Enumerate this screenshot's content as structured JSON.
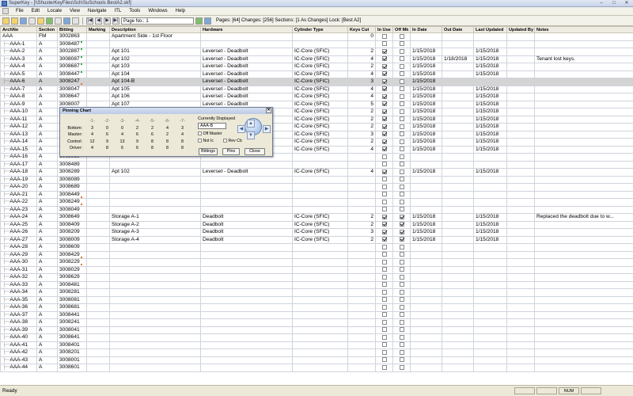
{
  "window": {
    "title": "SuperKey - [\\\\ShusterKeyFiles\\Sch\\SuSchools BestA2.skf]"
  },
  "menu": [
    "File",
    "Edit",
    "Locate",
    "View",
    "Navigate",
    "ITL",
    "Tools",
    "Windows",
    "Help"
  ],
  "toolbar": {
    "page_no": "Page No.: 1",
    "status": "Pages: [64]  Changes: [256]  Sections: [1 As Changes]  Lock: [Best A2]"
  },
  "columns": [
    "ArchNo",
    "Section",
    "Bitting",
    "Marking",
    "Description",
    "Hardware",
    "Cylinder Type",
    "Keys Cut",
    "In Use",
    "Off Mk",
    "In Date",
    "Out Date",
    "Last Updated",
    "Updated By",
    "Notes"
  ],
  "rows": [
    {
      "arch": "AAA",
      "section": "FM",
      "bitting": "3002863",
      "desc": "Apartment Side - 1st Floor",
      "hardware": "",
      "cyl": "",
      "keys": "0",
      "inuse": false,
      "offmk": false,
      "indate": "",
      "outdate": "",
      "updated": "",
      "by": "",
      "notes": "",
      "mark": ""
    },
    {
      "arch": "AAA-1",
      "section": "A",
      "bitting": "3008487",
      "desc": "",
      "hardware": "",
      "cyl": "",
      "keys": "",
      "inuse": false,
      "offmk": false,
      "indate": "",
      "outdate": "",
      "updated": "",
      "by": "",
      "notes": "",
      "mark": "g"
    },
    {
      "arch": "AAA-2",
      "section": "A",
      "bitting": "3002887",
      "desc": "Apt 101",
      "hardware": "Leverset - Deadbolt",
      "cyl": "IC-Core (SFIC)",
      "keys": "2",
      "inuse": true,
      "offmk": false,
      "indate": "1/15/2018",
      "outdate": "",
      "updated": "1/15/2018",
      "by": "",
      "notes": "",
      "mark": "g"
    },
    {
      "arch": "AAA-3",
      "section": "A",
      "bitting": "3008087",
      "desc": "Apt 102",
      "hardware": "Leverset - Deadbolt",
      "cyl": "IC-Core (SFIC)",
      "keys": "4",
      "inuse": true,
      "offmk": false,
      "indate": "1/15/2018",
      "outdate": "1/18/2018",
      "updated": "1/15/2018",
      "by": "",
      "notes": "Tenant lost keys.",
      "mark": "g"
    },
    {
      "arch": "AAA-4",
      "section": "A",
      "bitting": "3008687",
      "desc": "Apt 103",
      "hardware": "Leverset - Deadbolt",
      "cyl": "IC-Core (SFIC)",
      "keys": "2",
      "inuse": true,
      "offmk": false,
      "indate": "1/15/2018",
      "outdate": "",
      "updated": "1/15/2018",
      "by": "",
      "notes": "",
      "mark": "g"
    },
    {
      "arch": "AAA-5",
      "section": "A",
      "bitting": "3008447",
      "desc": "Apt 104",
      "hardware": "Leverset - Deadbolt",
      "cyl": "IC-Core (SFIC)",
      "keys": "4",
      "inuse": true,
      "offmk": false,
      "indate": "1/15/2018",
      "outdate": "",
      "updated": "1/15/2018",
      "by": "",
      "notes": "",
      "mark": "g"
    },
    {
      "arch": "AAA-6",
      "section": "A",
      "bitting": "3008247",
      "desc": "Apt 104-B",
      "hardware": "Leverset - Deadbolt",
      "cyl": "IC-Core (SFIC)",
      "keys": "3",
      "inuse": true,
      "offmk": false,
      "indate": "1/15/2018",
      "outdate": "",
      "updated": "",
      "by": "",
      "notes": "",
      "mark": "r",
      "selected": true
    },
    {
      "arch": "AAA-7",
      "section": "A",
      "bitting": "3008047",
      "desc": "Apt 105",
      "hardware": "Leverset - Deadbolt",
      "cyl": "IC-Core (SFIC)",
      "keys": "4",
      "inuse": true,
      "offmk": false,
      "indate": "1/15/2018",
      "outdate": "",
      "updated": "1/15/2018",
      "by": "",
      "notes": "",
      "mark": ""
    },
    {
      "arch": "AAA-8",
      "section": "A",
      "bitting": "3008647",
      "desc": "Apt 106",
      "hardware": "Leverset - Deadbolt",
      "cyl": "IC-Core (SFIC)",
      "keys": "4",
      "inuse": true,
      "offmk": false,
      "indate": "1/15/2018",
      "outdate": "",
      "updated": "1/15/2018",
      "by": "",
      "notes": "",
      "mark": ""
    },
    {
      "arch": "AAA-9",
      "section": "A",
      "bitting": "3008007",
      "desc": "Apt 107",
      "hardware": "Leverset - Deadbolt",
      "cyl": "IC-Core (SFIC)",
      "keys": "5",
      "inuse": true,
      "offmk": false,
      "indate": "1/15/2018",
      "outdate": "",
      "updated": "1/15/2018",
      "by": "",
      "notes": "",
      "mark": ""
    },
    {
      "arch": "AAA-10",
      "section": "A",
      "bitting": "",
      "desc": "",
      "hardware": "",
      "cyl": "IC-Core (SFIC)",
      "keys": "2",
      "inuse": true,
      "offmk": false,
      "indate": "1/15/2018",
      "outdate": "",
      "updated": "1/15/2018",
      "by": "",
      "notes": "",
      "mark": ""
    },
    {
      "arch": "AAA-11",
      "section": "A",
      "bitting": "",
      "desc": "",
      "hardware": "",
      "cyl": "IC-Core (SFIC)",
      "keys": "2",
      "inuse": true,
      "offmk": false,
      "indate": "1/15/2018",
      "outdate": "",
      "updated": "1/15/2018",
      "by": "",
      "notes": "",
      "mark": ""
    },
    {
      "arch": "AAA-12",
      "section": "A",
      "bitting": "",
      "desc": "",
      "hardware": "",
      "cyl": "IC-Core (SFIC)",
      "keys": "2",
      "inuse": true,
      "offmk": false,
      "indate": "1/15/2018",
      "outdate": "",
      "updated": "1/15/2018",
      "by": "",
      "notes": "",
      "mark": ""
    },
    {
      "arch": "AAA-13",
      "section": "A",
      "bitting": "",
      "desc": "",
      "hardware": "",
      "cyl": "IC-Core (SFIC)",
      "keys": "3",
      "inuse": true,
      "offmk": false,
      "indate": "1/15/2018",
      "outdate": "",
      "updated": "1/15/2018",
      "by": "",
      "notes": "",
      "mark": ""
    },
    {
      "arch": "AAA-14",
      "section": "A",
      "bitting": "",
      "desc": "",
      "hardware": "",
      "cyl": "IC-Core (SFIC)",
      "keys": "2",
      "inuse": true,
      "offmk": false,
      "indate": "1/15/2018",
      "outdate": "",
      "updated": "1/15/2018",
      "by": "",
      "notes": "",
      "mark": ""
    },
    {
      "arch": "AAA-15",
      "section": "A",
      "bitting": "",
      "desc": "",
      "hardware": "",
      "cyl": "IC-Core (SFIC)",
      "keys": "4",
      "inuse": true,
      "offmk": false,
      "indate": "1/15/2018",
      "outdate": "",
      "updated": "1/15/2018",
      "by": "",
      "notes": "",
      "mark": ""
    },
    {
      "arch": "AAA-16",
      "section": "A",
      "bitting": "3008089",
      "desc": "",
      "hardware": "",
      "cyl": "",
      "keys": "",
      "inuse": false,
      "offmk": false,
      "indate": "",
      "outdate": "",
      "updated": "",
      "by": "",
      "notes": "",
      "mark": ""
    },
    {
      "arch": "AAA-17",
      "section": "A",
      "bitting": "3008489",
      "desc": "",
      "hardware": "",
      "cyl": "",
      "keys": "",
      "inuse": false,
      "offmk": false,
      "indate": "",
      "outdate": "",
      "updated": "",
      "by": "",
      "notes": "",
      "mark": ""
    },
    {
      "arch": "AAA-18",
      "section": "A",
      "bitting": "3008289",
      "desc": "Apt 102",
      "hardware": "Leverset - Deadbolt",
      "cyl": "IC-Core (SFIC)",
      "keys": "4",
      "inuse": true,
      "offmk": false,
      "indate": "1/15/2018",
      "outdate": "",
      "updated": "1/15/2018",
      "by": "",
      "notes": "",
      "mark": ""
    },
    {
      "arch": "AAA-19",
      "section": "A",
      "bitting": "3008089",
      "desc": "",
      "hardware": "",
      "cyl": "",
      "keys": "",
      "inuse": false,
      "offmk": false,
      "indate": "",
      "outdate": "",
      "updated": "",
      "by": "",
      "notes": "",
      "mark": ""
    },
    {
      "arch": "AAA-20",
      "section": "A",
      "bitting": "3008689",
      "desc": "",
      "hardware": "",
      "cyl": "",
      "keys": "",
      "inuse": false,
      "offmk": false,
      "indate": "",
      "outdate": "",
      "updated": "",
      "by": "",
      "notes": "",
      "mark": ""
    },
    {
      "arch": "AAA-21",
      "section": "A",
      "bitting": "3008449",
      "desc": "",
      "hardware": "",
      "cyl": "",
      "keys": "",
      "inuse": false,
      "offmk": false,
      "indate": "",
      "outdate": "",
      "updated": "",
      "by": "",
      "notes": "",
      "mark": "r"
    },
    {
      "arch": "AAA-22",
      "section": "A",
      "bitting": "3008249",
      "desc": "",
      "hardware": "",
      "cyl": "",
      "keys": "",
      "inuse": false,
      "offmk": false,
      "indate": "",
      "outdate": "",
      "updated": "",
      "by": "",
      "notes": "",
      "mark": "r"
    },
    {
      "arch": "AAA-23",
      "section": "A",
      "bitting": "3008049",
      "desc": "",
      "hardware": "",
      "cyl": "",
      "keys": "",
      "inuse": false,
      "offmk": false,
      "indate": "",
      "outdate": "",
      "updated": "",
      "by": "",
      "notes": "",
      "mark": ""
    },
    {
      "arch": "AAA-24",
      "section": "A",
      "bitting": "3008649",
      "desc": "Storage A-1",
      "hardware": "Deadbolt",
      "cyl": "IC-Core (SFIC)",
      "keys": "2",
      "inuse": true,
      "offmk": true,
      "indate": "1/15/2018",
      "outdate": "",
      "updated": "1/15/2018",
      "by": "",
      "notes": "Replaced the deadbolt due to w...",
      "mark": ""
    },
    {
      "arch": "AAA-25",
      "section": "A",
      "bitting": "3008409",
      "desc": "Storage A-2",
      "hardware": "Deadbolt",
      "cyl": "IC-Core (SFIC)",
      "keys": "2",
      "inuse": true,
      "offmk": true,
      "indate": "1/15/2018",
      "outdate": "",
      "updated": "1/15/2018",
      "by": "",
      "notes": "",
      "mark": ""
    },
    {
      "arch": "AAA-26",
      "section": "A",
      "bitting": "3008209",
      "desc": "Storage A-3",
      "hardware": "Deadbolt",
      "cyl": "IC-Core (SFIC)",
      "keys": "3",
      "inuse": true,
      "offmk": true,
      "indate": "1/15/2018",
      "outdate": "",
      "updated": "1/15/2018",
      "by": "",
      "notes": "",
      "mark": ""
    },
    {
      "arch": "AAA-27",
      "section": "A",
      "bitting": "3008009",
      "desc": "Storage A-4",
      "hardware": "Deadbolt",
      "cyl": "IC-Core (SFIC)",
      "keys": "2",
      "inuse": true,
      "offmk": true,
      "indate": "1/15/2018",
      "outdate": "",
      "updated": "1/15/2018",
      "by": "",
      "notes": "",
      "mark": ""
    },
    {
      "arch": "AAA-28",
      "section": "A",
      "bitting": "3008609",
      "desc": "",
      "hardware": "",
      "cyl": "",
      "keys": "",
      "inuse": false,
      "offmk": false,
      "indate": "",
      "outdate": "",
      "updated": "",
      "by": "",
      "notes": "",
      "mark": ""
    },
    {
      "arch": "AAA-29",
      "section": "A",
      "bitting": "3008429",
      "desc": "",
      "hardware": "",
      "cyl": "",
      "keys": "",
      "inuse": false,
      "offmk": false,
      "indate": "",
      "outdate": "",
      "updated": "",
      "by": "",
      "notes": "",
      "mark": "r"
    },
    {
      "arch": "AAA-30",
      "section": "A",
      "bitting": "3008229",
      "desc": "",
      "hardware": "",
      "cyl": "",
      "keys": "",
      "inuse": false,
      "offmk": false,
      "indate": "",
      "outdate": "",
      "updated": "",
      "by": "",
      "notes": "",
      "mark": "r"
    },
    {
      "arch": "AAA-31",
      "section": "A",
      "bitting": "3008029",
      "desc": "",
      "hardware": "",
      "cyl": "",
      "keys": "",
      "inuse": false,
      "offmk": false,
      "indate": "",
      "outdate": "",
      "updated": "",
      "by": "",
      "notes": "",
      "mark": ""
    },
    {
      "arch": "AAA-32",
      "section": "A",
      "bitting": "3008629",
      "desc": "",
      "hardware": "",
      "cyl": "",
      "keys": "",
      "inuse": false,
      "offmk": false,
      "indate": "",
      "outdate": "",
      "updated": "",
      "by": "",
      "notes": "",
      "mark": ""
    },
    {
      "arch": "AAA-33",
      "section": "A",
      "bitting": "3008481",
      "desc": "",
      "hardware": "",
      "cyl": "",
      "keys": "",
      "inuse": false,
      "offmk": false,
      "indate": "",
      "outdate": "",
      "updated": "",
      "by": "",
      "notes": "",
      "mark": ""
    },
    {
      "arch": "AAA-34",
      "section": "A",
      "bitting": "3008281",
      "desc": "",
      "hardware": "",
      "cyl": "",
      "keys": "",
      "inuse": false,
      "offmk": false,
      "indate": "",
      "outdate": "",
      "updated": "",
      "by": "",
      "notes": "",
      "mark": ""
    },
    {
      "arch": "AAA-35",
      "section": "A",
      "bitting": "3008081",
      "desc": "",
      "hardware": "",
      "cyl": "",
      "keys": "",
      "inuse": false,
      "offmk": false,
      "indate": "",
      "outdate": "",
      "updated": "",
      "by": "",
      "notes": "",
      "mark": ""
    },
    {
      "arch": "AAA-36",
      "section": "A",
      "bitting": "3008681",
      "desc": "",
      "hardware": "",
      "cyl": "",
      "keys": "",
      "inuse": false,
      "offmk": false,
      "indate": "",
      "outdate": "",
      "updated": "",
      "by": "",
      "notes": "",
      "mark": ""
    },
    {
      "arch": "AAA-37",
      "section": "A",
      "bitting": "3008441",
      "desc": "",
      "hardware": "",
      "cyl": "",
      "keys": "",
      "inuse": false,
      "offmk": false,
      "indate": "",
      "outdate": "",
      "updated": "",
      "by": "",
      "notes": "",
      "mark": ""
    },
    {
      "arch": "AAA-38",
      "section": "A",
      "bitting": "3008241",
      "desc": "",
      "hardware": "",
      "cyl": "",
      "keys": "",
      "inuse": false,
      "offmk": false,
      "indate": "",
      "outdate": "",
      "updated": "",
      "by": "",
      "notes": "",
      "mark": ""
    },
    {
      "arch": "AAA-39",
      "section": "A",
      "bitting": "3008041",
      "desc": "",
      "hardware": "",
      "cyl": "",
      "keys": "",
      "inuse": false,
      "offmk": false,
      "indate": "",
      "outdate": "",
      "updated": "",
      "by": "",
      "notes": "",
      "mark": ""
    },
    {
      "arch": "AAA-40",
      "section": "A",
      "bitting": "3008641",
      "desc": "",
      "hardware": "",
      "cyl": "",
      "keys": "",
      "inuse": false,
      "offmk": false,
      "indate": "",
      "outdate": "",
      "updated": "",
      "by": "",
      "notes": "",
      "mark": ""
    },
    {
      "arch": "AAA-41",
      "section": "A",
      "bitting": "3008401",
      "desc": "",
      "hardware": "",
      "cyl": "",
      "keys": "",
      "inuse": false,
      "offmk": false,
      "indate": "",
      "outdate": "",
      "updated": "",
      "by": "",
      "notes": "",
      "mark": ""
    },
    {
      "arch": "AAA-42",
      "section": "A",
      "bitting": "3008201",
      "desc": "",
      "hardware": "",
      "cyl": "",
      "keys": "",
      "inuse": false,
      "offmk": false,
      "indate": "",
      "outdate": "",
      "updated": "",
      "by": "",
      "notes": "",
      "mark": ""
    },
    {
      "arch": "AAA-43",
      "section": "A",
      "bitting": "3008001",
      "desc": "",
      "hardware": "",
      "cyl": "",
      "keys": "",
      "inuse": false,
      "offmk": false,
      "indate": "",
      "outdate": "",
      "updated": "",
      "by": "",
      "notes": "",
      "mark": ""
    },
    {
      "arch": "AAA-44",
      "section": "A",
      "bitting": "3008601",
      "desc": "",
      "hardware": "",
      "cyl": "",
      "keys": "",
      "inuse": false,
      "offmk": false,
      "indate": "",
      "outdate": "",
      "updated": "",
      "by": "",
      "notes": "",
      "mark": ""
    }
  ],
  "pinning_chart": {
    "title": "Pinning Chart",
    "headers": [
      "-1-",
      "-2-",
      "-3-",
      "-4-",
      "-5-",
      "-6-",
      "-7-"
    ],
    "rows": [
      {
        "label": "Bottom:",
        "values": [
          "3",
          "0",
          "0",
          "2",
          "2",
          "4",
          "3"
        ]
      },
      {
        "label": "Master:",
        "values": [
          "4",
          "6",
          "4",
          "6",
          "6",
          "2",
          "4"
        ]
      },
      {
        "label": "Control:",
        "values": [
          "12",
          "9",
          "13",
          "9",
          "8",
          "8",
          "8"
        ]
      },
      {
        "label": "Driver:",
        "values": [
          "4",
          "8",
          "6",
          "6",
          "8",
          "8",
          "8"
        ]
      }
    ],
    "currently_label": "Currently Displayed",
    "currently_value": "AAA-B",
    "off_master": "Off Master",
    "not_ic": "Not Ic",
    "rev_cb": "Rev Cb",
    "buttons": {
      "bittings": "Bittings",
      "pins": "Pins",
      "close": "Close"
    }
  },
  "statusbar": {
    "ready": "Ready",
    "num": "NUM"
  }
}
